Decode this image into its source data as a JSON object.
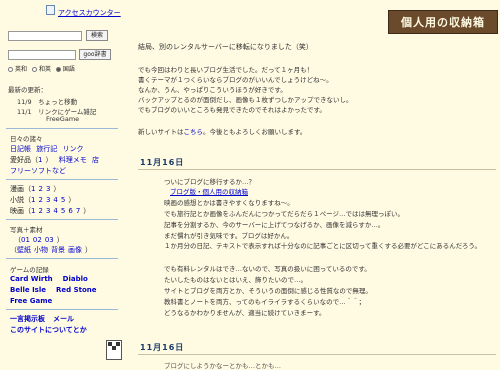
{
  "sidebar": {
    "counter_link": "アクセスカウンター",
    "search_button": "検索",
    "dict_button": "goo辞書",
    "radio_options": [
      "英和",
      "和英",
      "国語"
    ],
    "recent": {
      "title": "最新の更新：",
      "items": [
        "11/9　ちょっと移動",
        "11/1　リンクにゲーム雑記"
      ],
      "sub": "FreeGame"
    },
    "daily": {
      "title": "日々の諸々",
      "row1": [
        "日記帳",
        "旅行記",
        "リンク"
      ],
      "row2_label": "愛好品（",
      "row2_num": "1",
      "row2_close": "）",
      "row2_links": [
        "料理メモ",
        "店"
      ],
      "row3": "フリーソフトなど"
    },
    "manga": {
      "label": "漫画（",
      "links": [
        "1",
        "2",
        "3"
      ],
      "close": "）"
    },
    "novel": {
      "label": "小説（",
      "links": [
        "1",
        "2",
        "3",
        "4",
        "5"
      ],
      "close": "）"
    },
    "movie": {
      "label": "映画（",
      "links": [
        "1",
        "2",
        "3",
        "4",
        "5",
        "6",
        "7"
      ],
      "close": "）"
    },
    "photo": {
      "title": "写真＋素材",
      "row1_open": "（",
      "row1_links": [
        "01",
        "02",
        "03"
      ],
      "row1_close": "）",
      "row2_open": "（",
      "row2_links": [
        "壁紙",
        "小物",
        "背景",
        "画像"
      ],
      "row2_close": "）"
    },
    "games": {
      "title": "ゲームの記録",
      "rows": [
        [
          "Card Wirth",
          "Diablo"
        ],
        [
          "Belle Isle",
          "Red Stone"
        ],
        [
          "Free Game"
        ]
      ]
    },
    "misc": {
      "row1": [
        "一言掲示板",
        "メール"
      ],
      "row2": "このサイトについてとか"
    }
  },
  "header": {
    "logo_text": "個人用の収納箱"
  },
  "main": {
    "intro_title": "結局、別のレンタルサーバーに移転になりました（笑）",
    "intro_lines": [
      "でも今回はわりと長いブログ生活でした。だって１ヶ月も！",
      "書くテーマが１つくらいならブログのがいいんでしょうけどね〜。",
      "なんか、うん、やっぱりこういうほうが好きです。",
      "バックアップとるのが面倒だし、画像も１枚ずつしかアップできないし。",
      "でもブログのいいところも発見できたのでそれはよかったです。"
    ],
    "new_site_pre": "新しいサイトは",
    "new_site_link": "こちら",
    "new_site_post": "。今後ともよろしくお願いします。",
    "day1": {
      "header": "11月16日",
      "lines": [
        "ついにブログに移行するか…？",
        "ブログ版・個人用の収納箱",
        "映画の感想とかは書きやすくなりますね〜。",
        "でも旅行記とか画像をふんだんにつかってだらだら１ページ…ではは無理っぽい。",
        "記事を分割するか、今のサーバーに上げてつなげるか、画像を減らすか…。",
        "まだ慣れが引き気味です。ブログは好かん。",
        "１か月分の日記、テキストで表示すれば十分なのに記事ごとに区切って重くする必要がどこにあるんだろう。",
        "でも有料レンタルはでき…ないので、写真の扱いに困っているのです。",
        "たいしたものはないとはいえ、飾りたいので…。",
        "サイトとブログを両方とか、そういうの面倒に感じる性質なので無理。",
        "教科書とノートを両方、ってのもイライラするくらいなので…＾＾；",
        "どうなるかわかりませんが、適当に続けていきまーす。"
      ]
    },
    "day2": {
      "header": "11月16日",
      "partial": "ブログにしようかなーとかも…とかも…"
    }
  }
}
